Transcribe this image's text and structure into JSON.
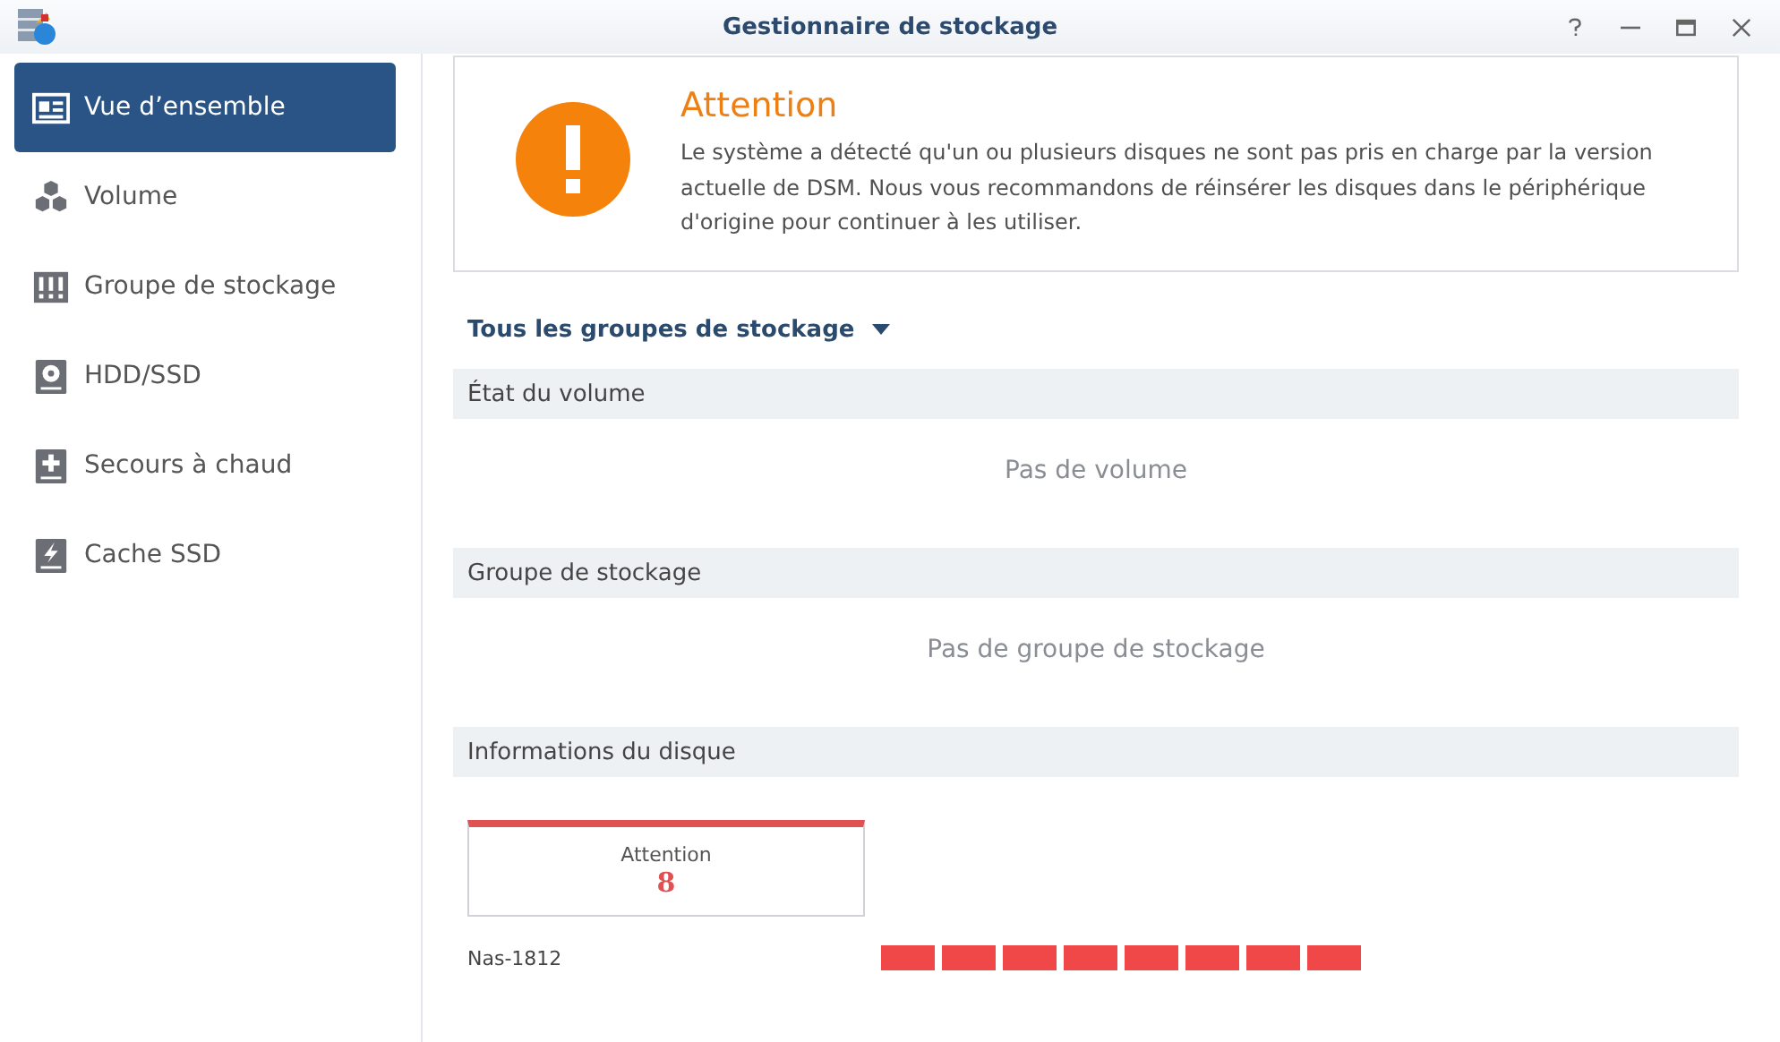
{
  "window": {
    "title": "Gestionnaire de stockage"
  },
  "sidebar": {
    "items": [
      {
        "label": "Vue d’ensemble",
        "kind": "overview",
        "selected": true
      },
      {
        "label": "Volume",
        "kind": "volume",
        "selected": false
      },
      {
        "label": "Groupe de stockage",
        "kind": "pool",
        "selected": false
      },
      {
        "label": "HDD/SSD",
        "kind": "disk",
        "selected": false
      },
      {
        "label": "Secours à chaud",
        "kind": "hotspare",
        "selected": false
      },
      {
        "label": "Cache SSD",
        "kind": "cache",
        "selected": false
      }
    ]
  },
  "alert": {
    "title": "Attention",
    "message": "Le système a détecté qu'un ou plusieurs disques ne sont pas pris en charge par la version actuelle de DSM. Nous vous recommandons de réinsérer les disques dans le périphérique d'origine pour continuer à les utiliser."
  },
  "filter": {
    "label": "Tous les groupes de stockage"
  },
  "sections": [
    {
      "title": "État du volume",
      "empty_text": "Pas de volume"
    },
    {
      "title": "Groupe de stockage",
      "empty_text": "Pas de groupe de stockage"
    },
    {
      "title": "Informations du disque"
    }
  ],
  "disk_summary": {
    "label": "Attention",
    "count": "8",
    "color": "#e05252"
  },
  "device": {
    "name": "Nas-1812",
    "disks": [
      {
        "color": "#f04848"
      },
      {
        "color": "#f04848"
      },
      {
        "color": "#f04848"
      },
      {
        "color": "#f04848"
      },
      {
        "color": "#f04848"
      },
      {
        "color": "#f04848"
      },
      {
        "color": "#f04848"
      },
      {
        "color": "#f04848"
      }
    ]
  }
}
